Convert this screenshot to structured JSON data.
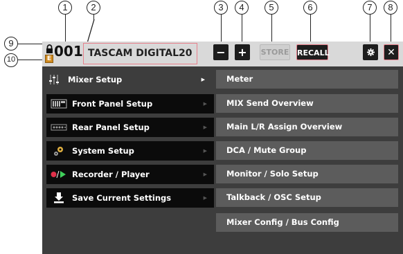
{
  "callouts": [
    "1",
    "2",
    "3",
    "4",
    "5",
    "6",
    "7",
    "8",
    "9",
    "10"
  ],
  "header": {
    "lock_icon": "lock-icon",
    "edited_badge": "E",
    "scene_number": "001",
    "scene_name": "TASCAM DIGITAL20",
    "minus_label": "−",
    "plus_label": "+",
    "store_label": "STORE",
    "recall_label": "RECALL",
    "settings_icon": "gear-icon",
    "close_label": "✕"
  },
  "menu": [
    {
      "label": "Mixer Setup",
      "icon": "mixer-faders-icon",
      "selected": true
    },
    {
      "label": "Front Panel Setup",
      "icon": "front-panel-icon"
    },
    {
      "label": "Rear Panel Setup",
      "icon": "rear-panel-icon"
    },
    {
      "label": "System Setup",
      "icon": "gears-icon"
    },
    {
      "label": "Recorder / Player",
      "icon": "record-play-icon"
    },
    {
      "label": "Save Current Settings",
      "icon": "download-icon"
    }
  ],
  "submenu": [
    {
      "label": "Meter"
    },
    {
      "label": "MIX Send Overview"
    },
    {
      "label": "Main L/R Assign Overview"
    },
    {
      "label": "DCA / Mute Group"
    },
    {
      "label": "Monitor / Solo Setup"
    },
    {
      "label": "Talkback / OSC Setup"
    },
    {
      "label": "Mixer Config / Bus Config"
    }
  ],
  "colors": {
    "screen_bg": "#3d3d3d",
    "topbar_bg": "#d9d9d9",
    "highlight_outline": "#e8808c",
    "edited_badge": "#d08a1f",
    "record_dot": "#e0304a",
    "play_arrow": "#3fcf5a"
  }
}
